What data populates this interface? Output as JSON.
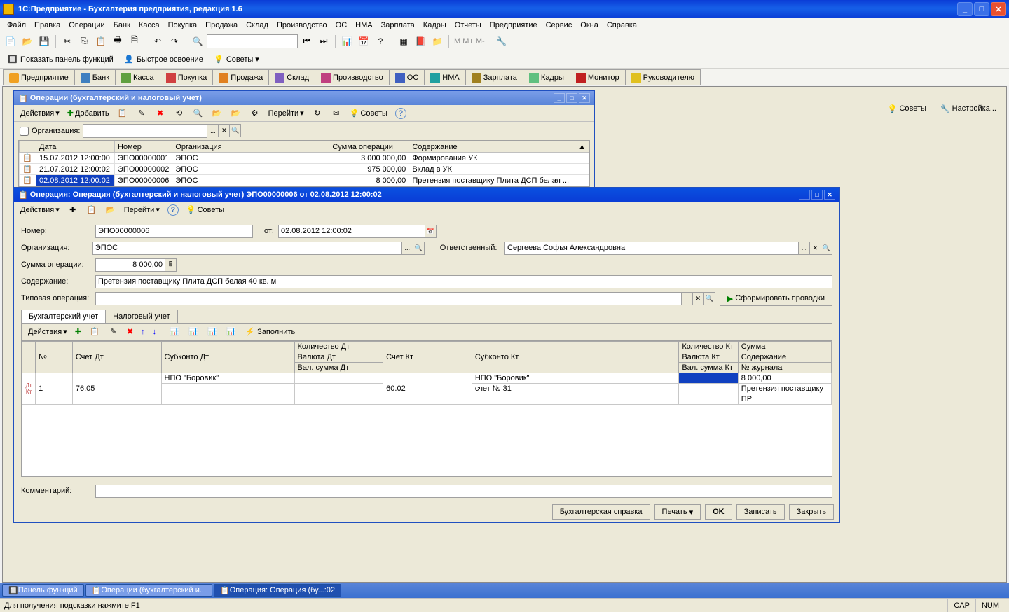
{
  "app": {
    "title": "1С:Предприятие - Бухгалтерия предприятия, редакция 1.6"
  },
  "menu": [
    "Файл",
    "Правка",
    "Операции",
    "Банк",
    "Касса",
    "Покупка",
    "Продажа",
    "Склад",
    "Производство",
    "ОС",
    "НМА",
    "Зарплата",
    "Кадры",
    "Отчеты",
    "Предприятие",
    "Сервис",
    "Окна",
    "Справка"
  ],
  "funcbar": {
    "show_panel": "Показать панель функций",
    "quick_start": "Быстрое освоение",
    "tips": "Советы"
  },
  "functabs": [
    "Предприятие",
    "Банк",
    "Касса",
    "Покупка",
    "Продажа",
    "Склад",
    "Производство",
    "ОС",
    "НМА",
    "Зарплата",
    "Кадры",
    "Монитор",
    "Руководителю"
  ],
  "right_tools": {
    "tips": "Советы",
    "settings": "Настройка..."
  },
  "list_window": {
    "title": "Операции (бухгалтерский и налоговый учет)",
    "toolbar": {
      "actions": "Действия",
      "add": "Добавить",
      "goto": "Перейти",
      "tips": "Советы"
    },
    "filter": {
      "org_label": "Организация:"
    },
    "columns": [
      "",
      "Дата",
      "Номер",
      "Организация",
      "Сумма операции",
      "Содержание"
    ],
    "rows": [
      {
        "date": "15.07.2012 12:00:00",
        "num": "ЭПО00000001",
        "org": "ЭПОС",
        "sum": "3 000 000,00",
        "desc": "Формирование УК"
      },
      {
        "date": "21.07.2012 12:00:02",
        "num": "ЭПО00000002",
        "org": "ЭПОС",
        "sum": "975 000,00",
        "desc": "Вклад в УК"
      },
      {
        "date": "02.08.2012 12:00:02",
        "num": "ЭПО00000006",
        "org": "ЭПОС",
        "sum": "8 000,00",
        "desc": "Претензия поставщику Плита ДСП белая ..."
      }
    ]
  },
  "op_window": {
    "title": "Операция: Операция (бухгалтерский и налоговый учет) ЭПО00000006 от 02.08.2012 12:00:02",
    "toolbar": {
      "actions": "Действия",
      "goto": "Перейти",
      "tips": "Советы"
    },
    "fields": {
      "number_label": "Номер:",
      "number": "ЭПО00000006",
      "from_label": "от:",
      "date": "02.08.2012 12:00:02",
      "org_label": "Организация:",
      "org": "ЭПОС",
      "responsible_label": "Ответственный:",
      "responsible": "Сергеева Софья Александровна",
      "sum_label": "Сумма операции:",
      "sum": "8 000,00",
      "content_label": "Содержание:",
      "content": "Претензия поставщику Плита ДСП белая 40 кв. м",
      "typical_label": "Типовая операция:",
      "typical": "",
      "form_entries": "Сформировать проводки",
      "comment_label": "Комментарий:",
      "comment": ""
    },
    "tabs": [
      "Бухгалтерский учет",
      "Налоговый учет"
    ],
    "inner_toolbar": {
      "actions": "Действия",
      "fill": "Заполнить"
    },
    "grid_headers": {
      "n": "№",
      "acc_dt": "Счет Дт",
      "sub_dt": "Субконто Дт",
      "qty_dt": "Количество Дт",
      "cur_dt": "Валюта Дт",
      "cursum_dt": "Вал. сумма Дт",
      "acc_kt": "Счет Кт",
      "sub_kt": "Субконто Кт",
      "qty_kt": "Количество Кт",
      "cur_kt": "Валюта Кт",
      "cursum_kt": "Вал. сумма Кт",
      "sum": "Сумма",
      "cont": "Содержание",
      "journal": "№ журнала"
    },
    "grid_row": {
      "n": "1",
      "acc_dt": "76.05",
      "sub_dt": "НПО \"Боровик\"",
      "acc_kt": "60.02",
      "sub_kt1": "НПО \"Боровик\"",
      "sub_kt2": "счет № 31",
      "sum": "8 000,00",
      "cont": "Претензия поставщику",
      "journal": "ПР"
    },
    "buttons": {
      "report": "Бухгалтерская справка",
      "print": "Печать",
      "ok": "OK",
      "save": "Записать",
      "close": "Закрыть"
    }
  },
  "taskbar": [
    "Панель функций",
    "Операции (бухгалтерский и...",
    "Операция: Операция (бу...:02"
  ],
  "statusbar": {
    "hint": "Для получения подсказки нажмите F1",
    "cap": "CAP",
    "num": "NUM"
  }
}
